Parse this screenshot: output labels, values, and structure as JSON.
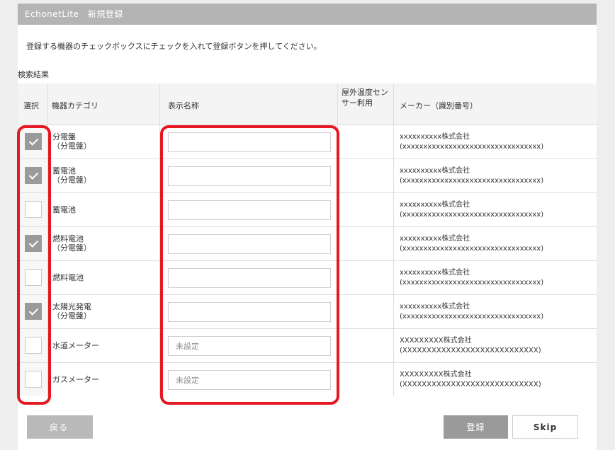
{
  "window": {
    "title": "EchonetLite　新規登録"
  },
  "instruction": "登録する機器のチェックボックスにチェックを入れて登録ボタンを押してください。",
  "section_label": "検索結果",
  "table": {
    "headers": {
      "select": "選択",
      "category": "機器カテゴリ",
      "display_name": "表示名称",
      "sensor": "屋外温度センサー利用",
      "maker": "メーカー（識別番号）"
    },
    "rows": [
      {
        "checked": true,
        "category": "分電盤",
        "sub": "（分電盤）",
        "name_value": "",
        "name_placeholder": "",
        "maker": "xxxxxxxxxx株式会社",
        "maker_id": "(xxxxxxxxxxxxxxxxxxxxxxxxxxxxxxxxx)"
      },
      {
        "checked": true,
        "category": "蓄電池",
        "sub": "（分電盤）",
        "name_value": "",
        "name_placeholder": "",
        "maker": "xxxxxxxxxx株式会社",
        "maker_id": "(xxxxxxxxxxxxxxxxxxxxxxxxxxxxxxxxx)"
      },
      {
        "checked": false,
        "category": "蓄電池",
        "sub": "",
        "name_value": "",
        "name_placeholder": "",
        "maker": "xxxxxxxxxx株式会社",
        "maker_id": "(xxxxxxxxxxxxxxxxxxxxxxxxxxxxxxxxx)"
      },
      {
        "checked": true,
        "category": "燃料電池",
        "sub": "（分電盤）",
        "name_value": "",
        "name_placeholder": "",
        "maker": "xxxxxxxxxx株式会社",
        "maker_id": "(xxxxxxxxxxxxxxxxxxxxxxxxxxxxxxxxx)"
      },
      {
        "checked": false,
        "category": "燃料電池",
        "sub": "",
        "name_value": "",
        "name_placeholder": "",
        "maker": "xxxxxxxxxx株式会社",
        "maker_id": "(xxxxxxxxxxxxxxxxxxxxxxxxxxxxxxxxx)"
      },
      {
        "checked": true,
        "category": "太陽光発電",
        "sub": "（分電盤）",
        "name_value": "",
        "name_placeholder": "",
        "maker": "xxxxxxxxxx株式会社",
        "maker_id": "(xxxxxxxxxxxxxxxxxxxxxxxxxxxxxxxxx)"
      },
      {
        "checked": false,
        "category": "水道メーター",
        "sub": "",
        "name_value": "",
        "name_placeholder": "未設定",
        "maker": "XXXXXXXXX株式会社",
        "maker_id": "(XXXXXXXXXXXXXXXXXXXXXXXXXXXX)"
      },
      {
        "checked": false,
        "category": "ガスメーター",
        "sub": "",
        "name_value": "",
        "name_placeholder": "未設定",
        "maker": "XXXXXXXXX株式会社",
        "maker_id": "(XXXXXXXXXXXXXXXXXXXXXXXXXXXX)"
      }
    ]
  },
  "buttons": {
    "back": "戻る",
    "register": "登録",
    "skip": "Skip"
  },
  "colors": {
    "highlight": "#e61822",
    "titlebar": "#b4b4b4",
    "checked": "#9a9a9a"
  }
}
